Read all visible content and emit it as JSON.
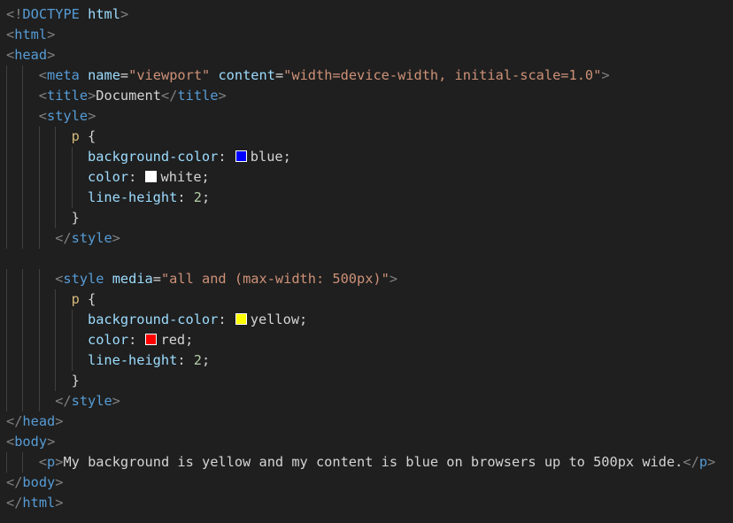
{
  "editor": {
    "language": "html",
    "lines": [
      {
        "indent": 0,
        "tokens": [
          [
            "bracket",
            "<!"
          ],
          [
            "doctype",
            "DOCTYPE"
          ],
          [
            "text",
            " "
          ],
          [
            "attr",
            "html"
          ],
          [
            "bracket",
            ">"
          ]
        ]
      },
      {
        "indent": 0,
        "tokens": [
          [
            "bracket",
            "<"
          ],
          [
            "tag",
            "html"
          ],
          [
            "bracket",
            ">"
          ]
        ]
      },
      {
        "indent": 0,
        "tokens": [
          [
            "bracket",
            "<"
          ],
          [
            "tag",
            "head"
          ],
          [
            "bracket",
            ">"
          ]
        ]
      },
      {
        "indent": 4,
        "tokens": [
          [
            "bracket",
            "<"
          ],
          [
            "tag",
            "meta"
          ],
          [
            "text",
            " "
          ],
          [
            "attr",
            "name"
          ],
          [
            "punc",
            "="
          ],
          [
            "str",
            "\"viewport\""
          ],
          [
            "text",
            " "
          ],
          [
            "attr",
            "content"
          ],
          [
            "punc",
            "="
          ],
          [
            "str",
            "\"width=device-width, initial-scale=1.0\""
          ],
          [
            "bracket",
            ">"
          ]
        ]
      },
      {
        "indent": 4,
        "tokens": [
          [
            "bracket",
            "<"
          ],
          [
            "tag",
            "title"
          ],
          [
            "bracket",
            ">"
          ],
          [
            "text",
            "Document"
          ],
          [
            "bracket",
            "</"
          ],
          [
            "tag",
            "title"
          ],
          [
            "bracket",
            ">"
          ]
        ]
      },
      {
        "indent": 4,
        "tokens": [
          [
            "bracket",
            "<"
          ],
          [
            "tag",
            "style"
          ],
          [
            "bracket",
            ">"
          ]
        ]
      },
      {
        "indent": 8,
        "tokens": [
          [
            "sel",
            "p"
          ],
          [
            "punc",
            " {"
          ]
        ]
      },
      {
        "indent": 10,
        "tokens": [
          [
            "prop",
            "background-color"
          ],
          [
            "punc",
            ": "
          ],
          [
            "swatch",
            "#0000ff"
          ],
          [
            "text",
            "blue"
          ],
          [
            "punc",
            ";"
          ]
        ]
      },
      {
        "indent": 10,
        "tokens": [
          [
            "prop",
            "color"
          ],
          [
            "punc",
            ": "
          ],
          [
            "swatch",
            "#ffffff"
          ],
          [
            "text",
            "white"
          ],
          [
            "punc",
            ";"
          ]
        ]
      },
      {
        "indent": 10,
        "tokens": [
          [
            "prop",
            "line-height"
          ],
          [
            "punc",
            ": "
          ],
          [
            "num",
            "2"
          ],
          [
            "punc",
            ";"
          ]
        ]
      },
      {
        "indent": 8,
        "tokens": [
          [
            "punc",
            "}"
          ]
        ]
      },
      {
        "indent": 6,
        "tokens": [
          [
            "bracket",
            "</"
          ],
          [
            "tag",
            "style"
          ],
          [
            "bracket",
            ">"
          ]
        ]
      },
      {
        "indent": 0,
        "tokens": []
      },
      {
        "indent": 6,
        "tokens": [
          [
            "bracket",
            "<"
          ],
          [
            "tag",
            "style"
          ],
          [
            "text",
            " "
          ],
          [
            "attr",
            "media"
          ],
          [
            "punc",
            "="
          ],
          [
            "str",
            "\"all and (max-width: 500px)\""
          ],
          [
            "bracket",
            ">"
          ]
        ]
      },
      {
        "indent": 8,
        "tokens": [
          [
            "sel",
            "p"
          ],
          [
            "punc",
            " {"
          ]
        ]
      },
      {
        "indent": 10,
        "tokens": [
          [
            "prop",
            "background-color"
          ],
          [
            "punc",
            ": "
          ],
          [
            "swatch",
            "#ffff00"
          ],
          [
            "text",
            "yellow"
          ],
          [
            "punc",
            ";"
          ]
        ]
      },
      {
        "indent": 10,
        "tokens": [
          [
            "prop",
            "color"
          ],
          [
            "punc",
            ": "
          ],
          [
            "swatch",
            "#ff0000"
          ],
          [
            "text",
            "red"
          ],
          [
            "punc",
            ";"
          ]
        ]
      },
      {
        "indent": 10,
        "tokens": [
          [
            "prop",
            "line-height"
          ],
          [
            "punc",
            ": "
          ],
          [
            "num",
            "2"
          ],
          [
            "punc",
            ";"
          ]
        ]
      },
      {
        "indent": 8,
        "tokens": [
          [
            "punc",
            "}"
          ]
        ]
      },
      {
        "indent": 6,
        "tokens": [
          [
            "bracket",
            "</"
          ],
          [
            "tag",
            "style"
          ],
          [
            "bracket",
            ">"
          ]
        ]
      },
      {
        "indent": 0,
        "tokens": [
          [
            "bracket",
            "</"
          ],
          [
            "tag",
            "head"
          ],
          [
            "bracket",
            ">"
          ]
        ]
      },
      {
        "indent": 0,
        "tokens": [
          [
            "bracket",
            "<"
          ],
          [
            "tag",
            "body"
          ],
          [
            "bracket",
            ">"
          ]
        ]
      },
      {
        "indent": 4,
        "tokens": [
          [
            "bracket",
            "<"
          ],
          [
            "tag",
            "p"
          ],
          [
            "bracket",
            ">"
          ],
          [
            "text",
            "My background is yellow and my content is blue on browsers up to 500px wide."
          ],
          [
            "bracket",
            "</"
          ],
          [
            "tag",
            "p"
          ],
          [
            "bracket",
            ">"
          ]
        ]
      },
      {
        "indent": 0,
        "tokens": [
          [
            "bracket",
            "</"
          ],
          [
            "tag",
            "body"
          ],
          [
            "bracket",
            ">"
          ]
        ]
      },
      {
        "indent": 0,
        "tokens": [
          [
            "bracket",
            "</"
          ],
          [
            "tag",
            "html"
          ],
          [
            "bracket",
            ">"
          ]
        ]
      }
    ]
  }
}
